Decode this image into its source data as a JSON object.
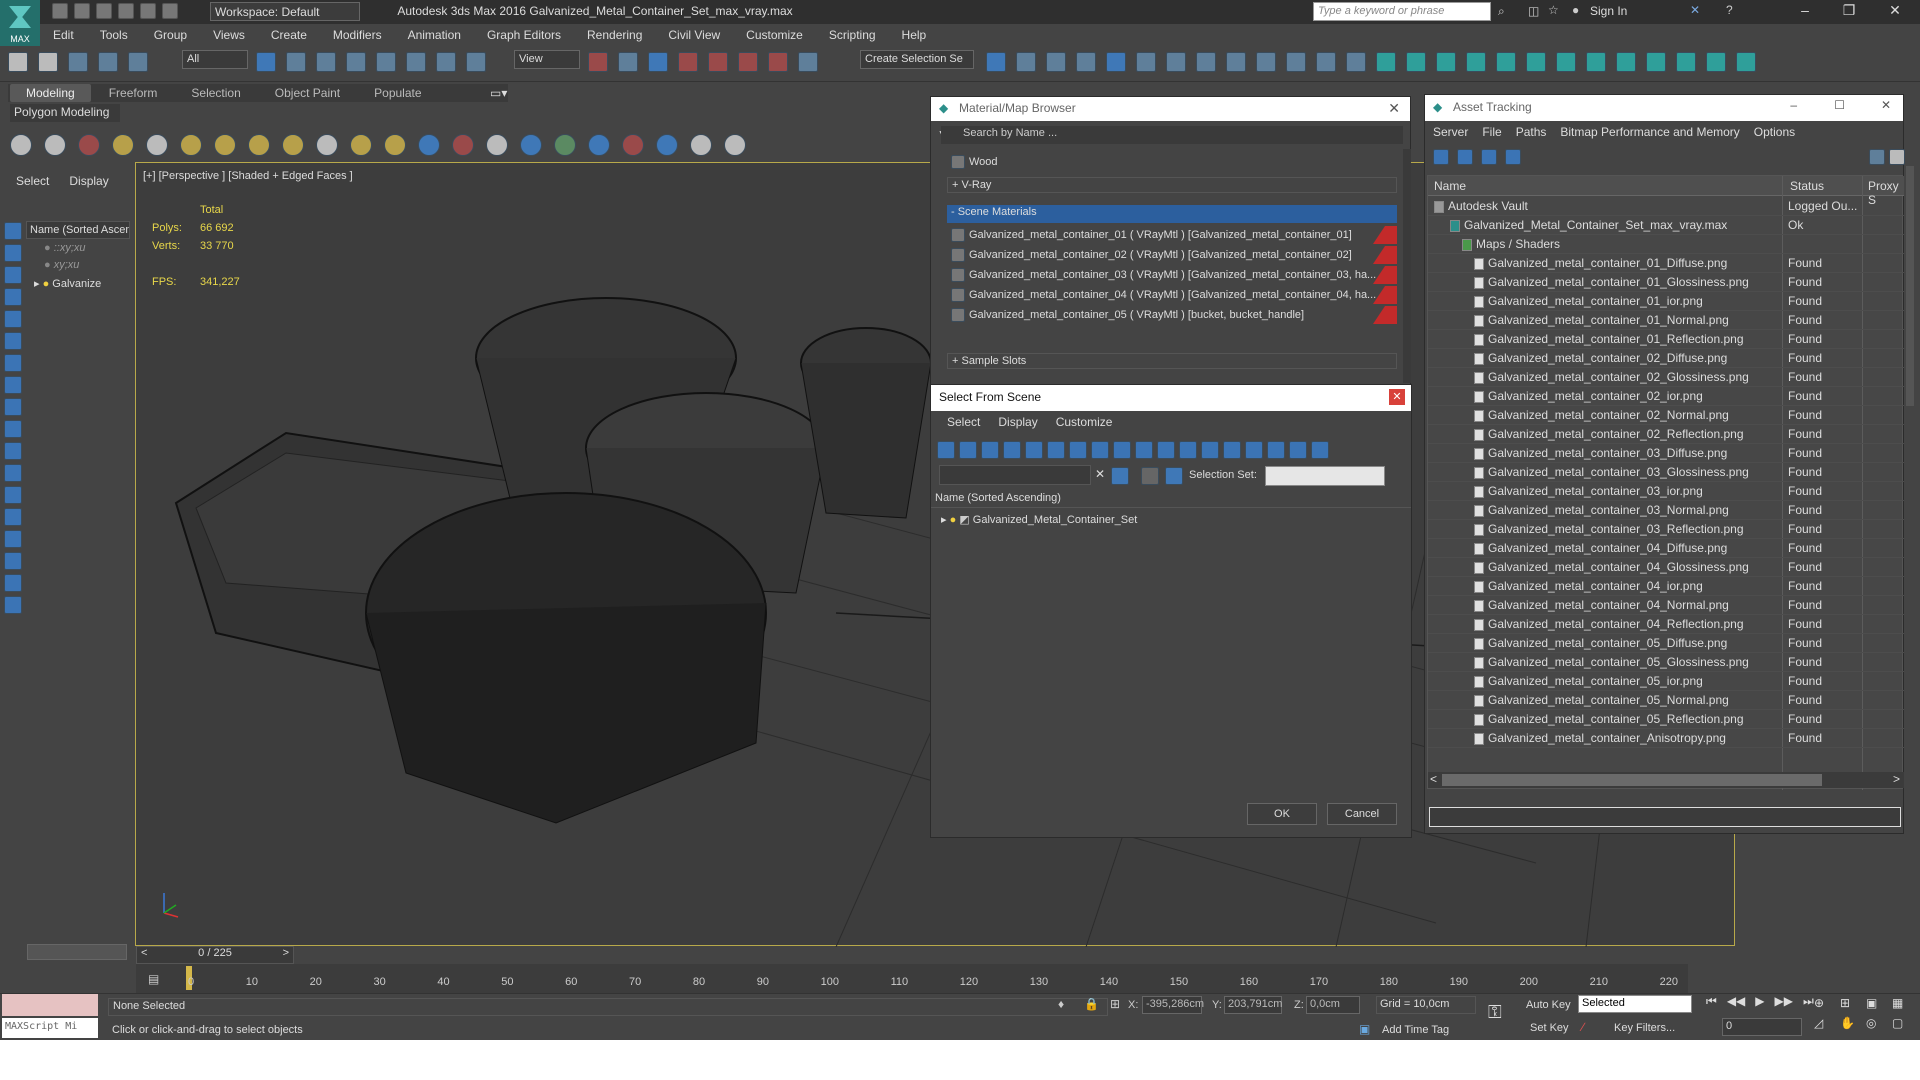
{
  "app": {
    "workspace": "Workspace: Default",
    "title": "Autodesk 3ds Max 2016     Galvanized_Metal_Container_Set_max_vray.max",
    "search_placeholder": "Type a keyword or phrase",
    "sign_in": "Sign In",
    "logo_text": "MAX"
  },
  "menu": [
    "Edit",
    "Tools",
    "Group",
    "Views",
    "Create",
    "Modifiers",
    "Animation",
    "Graph Editors",
    "Rendering",
    "Civil View",
    "Customize",
    "Scripting",
    "Help"
  ],
  "toolbar": {
    "filter_value": "All",
    "refcoord_value": "View",
    "named_selection": "Create Selection Se"
  },
  "ribbon": {
    "tabs": [
      "Modeling",
      "Freeform",
      "Selection",
      "Object Paint",
      "Populate"
    ],
    "active_tab": "Modeling",
    "subtitle": "Polygon Modeling"
  },
  "scene_explorer": {
    "tabs": [
      "Select",
      "Display"
    ],
    "header": "Name (Sorted Ascending)",
    "rows": [
      "(Cross)",
      "(Cross)",
      "Galvanized_Metal_Container_Set"
    ],
    "row_labels": [
      "::xy;xu",
      "xy;xu",
      "Galvanize"
    ]
  },
  "viewport": {
    "label": "[+] [Perspective ] [Shaded + Edged Faces ]",
    "stats": {
      "total_label": "Total",
      "polys_label": "Polys:",
      "polys": "66 692",
      "verts_label": "Verts:",
      "verts": "33 770",
      "fps_label": "FPS:",
      "fps": "341,227"
    }
  },
  "timeline": {
    "frame": "0 / 225",
    "ticks": [
      "0",
      "10",
      "20",
      "30",
      "40",
      "50",
      "60",
      "70",
      "80",
      "90",
      "100",
      "110",
      "120",
      "130",
      "140",
      "150",
      "160",
      "170",
      "180",
      "190",
      "200",
      "210",
      "220"
    ]
  },
  "status": {
    "maxscript": "MAXScript Mi",
    "selection": "None Selected",
    "prompt": "Click or click-and-drag to select objects",
    "x_label": "X:",
    "x": "-395,286cm",
    "y_label": "Y:",
    "y": "203,791cm",
    "z_label": "Z:",
    "z": "0,0cm",
    "grid": "Grid = 10,0cm",
    "add_time_tag": "Add Time Tag",
    "auto_key": "Auto Key",
    "set_key": "Set Key",
    "selected_dd": "Selected",
    "key_filters": "Key Filters...",
    "frame_field": "0"
  },
  "material_browser": {
    "title": "Material/Map Browser",
    "search": "Search by Name ...",
    "wood": "Wood",
    "vray_group": "+ V-Ray",
    "scene_group": "- Scene Materials",
    "materials": [
      "Galvanized_metal_container_01  ( VRayMtl ) [Galvanized_metal_container_01]",
      "Galvanized_metal_container_02  ( VRayMtl ) [Galvanized_metal_container_02]",
      "Galvanized_metal_container_03  ( VRayMtl ) [Galvanized_metal_container_03, ha...",
      "Galvanized_metal_container_04  ( VRayMtl ) [Galvanized_metal_container_04, ha...",
      "Galvanized_metal_container_05  ( VRayMtl ) [bucket, bucket_handle]"
    ],
    "sample_slots": "+ Sample Slots"
  },
  "select_from_scene": {
    "title": "Select From Scene",
    "menu": [
      "Select",
      "Display",
      "Customize"
    ],
    "selection_set_label": "Selection Set:",
    "column": "Name (Sorted Ascending)",
    "row": "Galvanized_Metal_Container_Set",
    "ok": "OK",
    "cancel": "Cancel"
  },
  "asset_tracking": {
    "title": "Asset Tracking",
    "menu": [
      "Server",
      "File",
      "Paths",
      "Bitmap Performance and Memory",
      "Options"
    ],
    "columns": [
      "Name",
      "Status",
      "Proxy S"
    ],
    "rows": [
      {
        "name": "Autodesk Vault",
        "status": "Logged Ou...",
        "level": 1
      },
      {
        "name": "Galvanized_Metal_Container_Set_max_vray.max",
        "status": "Ok",
        "level": 2
      },
      {
        "name": "Maps / Shaders",
        "status": "",
        "level": 3
      },
      {
        "name": "Galvanized_metal_container_01_Diffuse.png",
        "status": "Found",
        "level": 4
      },
      {
        "name": "Galvanized_metal_container_01_Glossiness.png",
        "status": "Found",
        "level": 4
      },
      {
        "name": "Galvanized_metal_container_01_ior.png",
        "status": "Found",
        "level": 4
      },
      {
        "name": "Galvanized_metal_container_01_Normal.png",
        "status": "Found",
        "level": 4
      },
      {
        "name": "Galvanized_metal_container_01_Reflection.png",
        "status": "Found",
        "level": 4
      },
      {
        "name": "Galvanized_metal_container_02_Diffuse.png",
        "status": "Found",
        "level": 4
      },
      {
        "name": "Galvanized_metal_container_02_Glossiness.png",
        "status": "Found",
        "level": 4
      },
      {
        "name": "Galvanized_metal_container_02_ior.png",
        "status": "Found",
        "level": 4
      },
      {
        "name": "Galvanized_metal_container_02_Normal.png",
        "status": "Found",
        "level": 4
      },
      {
        "name": "Galvanized_metal_container_02_Reflection.png",
        "status": "Found",
        "level": 4
      },
      {
        "name": "Galvanized_metal_container_03_Diffuse.png",
        "status": "Found",
        "level": 4
      },
      {
        "name": "Galvanized_metal_container_03_Glossiness.png",
        "status": "Found",
        "level": 4
      },
      {
        "name": "Galvanized_metal_container_03_ior.png",
        "status": "Found",
        "level": 4
      },
      {
        "name": "Galvanized_metal_container_03_Normal.png",
        "status": "Found",
        "level": 4
      },
      {
        "name": "Galvanized_metal_container_03_Reflection.png",
        "status": "Found",
        "level": 4
      },
      {
        "name": "Galvanized_metal_container_04_Diffuse.png",
        "status": "Found",
        "level": 4
      },
      {
        "name": "Galvanized_metal_container_04_Glossiness.png",
        "status": "Found",
        "level": 4
      },
      {
        "name": "Galvanized_metal_container_04_ior.png",
        "status": "Found",
        "level": 4
      },
      {
        "name": "Galvanized_metal_container_04_Normal.png",
        "status": "Found",
        "level": 4
      },
      {
        "name": "Galvanized_metal_container_04_Reflection.png",
        "status": "Found",
        "level": 4
      },
      {
        "name": "Galvanized_metal_container_05_Diffuse.png",
        "status": "Found",
        "level": 4
      },
      {
        "name": "Galvanized_metal_container_05_Glossiness.png",
        "status": "Found",
        "level": 4
      },
      {
        "name": "Galvanized_metal_container_05_ior.png",
        "status": "Found",
        "level": 4
      },
      {
        "name": "Galvanized_metal_container_05_Normal.png",
        "status": "Found",
        "level": 4
      },
      {
        "name": "Galvanized_metal_container_05_Reflection.png",
        "status": "Found",
        "level": 4
      },
      {
        "name": "Galvanized_metal_container_Anisotropy.png",
        "status": "Found",
        "level": 4
      }
    ]
  },
  "colors": {
    "app_bg": "#444444",
    "viewport_border": "#b8a94a",
    "stats_yellow": "#e8d74a",
    "scene_materials_header": "#2c5f9e",
    "material_swatch_red": "#c32a2a",
    "maxscript_pink": "#e6c2c2"
  }
}
